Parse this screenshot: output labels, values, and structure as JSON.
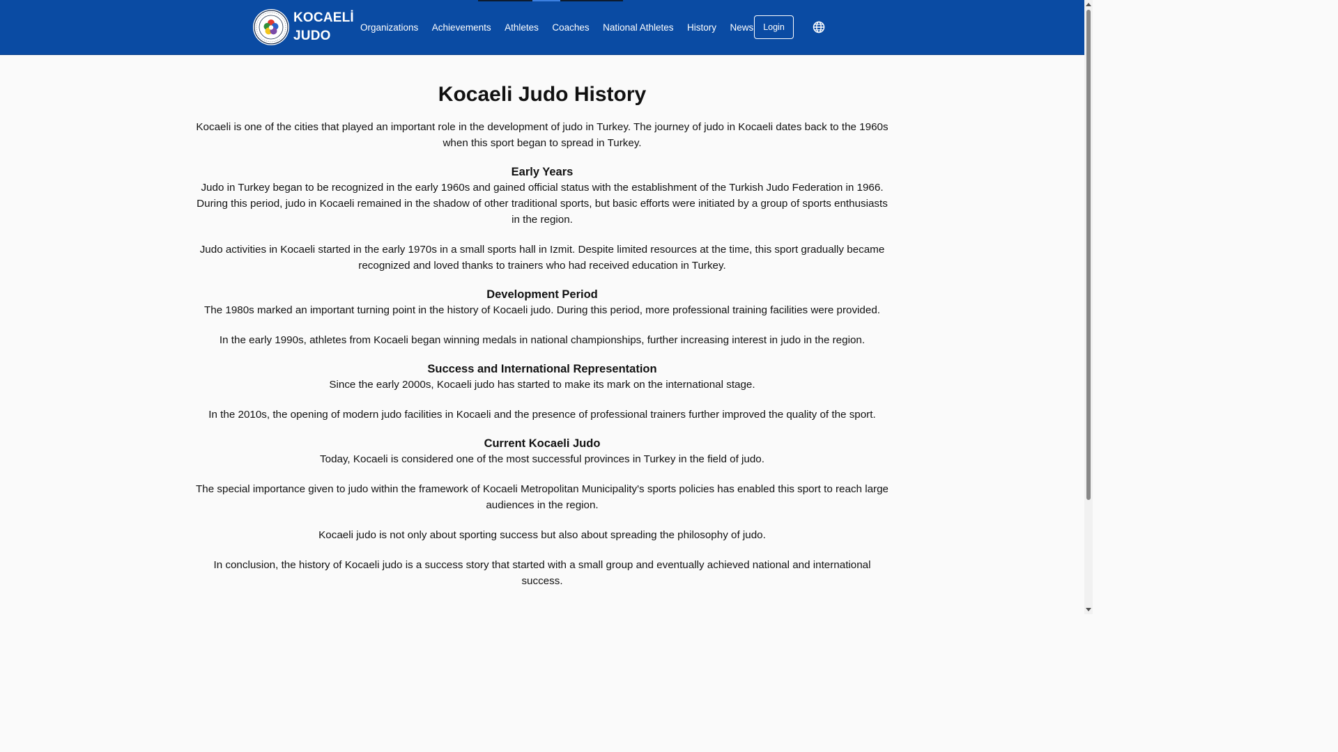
{
  "brand": {
    "line1": "KOCAELİ",
    "line2": "JUDO",
    "logo_icon": "international-judo-federation-logo-icon"
  },
  "nav": {
    "items": [
      "Organizations",
      "Achievements",
      "Athletes",
      "Coaches",
      "National Athletes",
      "History",
      "News"
    ],
    "login_label": "Login",
    "language_icon": "globe-icon"
  },
  "page": {
    "title": "Kocaeli Judo History",
    "intro": "Kocaeli is one of the cities that played an important role in the development of judo in Turkey. The journey of judo in Kocaeli dates back to the 1960s when this sport began to spread in Turkey.",
    "sections": [
      {
        "heading": "Early Years",
        "paragraphs": [
          "Judo in Turkey began to be recognized in the early 1960s and gained official status with the establishment of the Turkish Judo Federation in 1966. During this period, judo in Kocaeli remained in the shadow of other traditional sports, but basic efforts were initiated by a group of sports enthusiasts in the region.",
          "Judo activities in Kocaeli started in the early 1970s in a small sports hall in Izmit. Despite limited resources at the time, this sport gradually became recognized and loved thanks to trainers who had received education in Turkey."
        ]
      },
      {
        "heading": "Development Period",
        "paragraphs": [
          "The 1980s marked an important turning point in the history of Kocaeli judo. During this period, more professional training facilities were provided.",
          "In the early 1990s, athletes from Kocaeli began winning medals in national championships, further increasing interest in judo in the region."
        ]
      },
      {
        "heading": "Success and International Representation",
        "paragraphs": [
          "Since the early 2000s, Kocaeli judo has started to make its mark on the international stage.",
          "In the 2010s, the opening of modern judo facilities in Kocaeli and the presence of professional trainers further improved the quality of the sport."
        ]
      },
      {
        "heading": "Current Kocaeli Judo",
        "paragraphs": [
          "Today, Kocaeli is considered one of the most successful provinces in Turkey in the field of judo.",
          "The special importance given to judo within the framework of Kocaeli Metropolitan Municipality's sports policies has enabled this sport to reach large audiences in the region.",
          "Kocaeli judo is not only about sporting success but also about spreading the philosophy of judo.",
          "In conclusion, the history of Kocaeli judo is a success story that started with a small group and eventually achieved national and international success."
        ]
      }
    ]
  },
  "colors": {
    "navbar_bg": "#0a4ba3",
    "page_bg": "#fafafa",
    "text": "#111111"
  }
}
